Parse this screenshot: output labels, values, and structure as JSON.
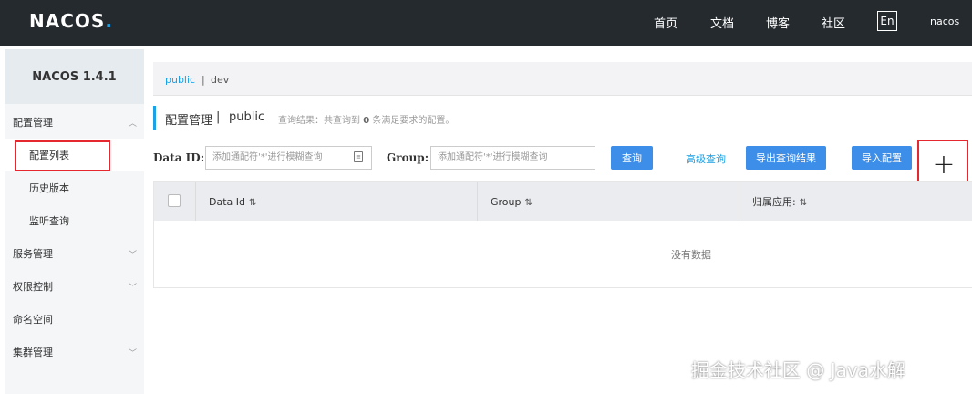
{
  "header": {
    "logo_text": "NACOS",
    "logo_dot": ".",
    "nav": [
      "首页",
      "文档",
      "博客",
      "社区"
    ],
    "lang_button": "En",
    "user": "nacos"
  },
  "sidebar": {
    "version": "NACOS 1.4.1",
    "items": [
      {
        "label": "配置管理",
        "chevron": "︿"
      },
      {
        "label": "配置列表"
      },
      {
        "label": "历史版本"
      },
      {
        "label": "监听查询"
      },
      {
        "label": "服务管理",
        "chevron": "﹀"
      },
      {
        "label": "权限控制",
        "chevron": "﹀"
      },
      {
        "label": "命名空间"
      },
      {
        "label": "集群管理",
        "chevron": "﹀"
      }
    ]
  },
  "namespace_bar": {
    "public": "public",
    "separator": "|",
    "dev": "dev"
  },
  "page": {
    "title": "配置管理",
    "title_separator": "|",
    "namespace": "public",
    "result_prefix": "查询结果：共查询到",
    "result_count": "0",
    "result_suffix": "条满足要求的配置。"
  },
  "filters": {
    "data_id_label": "Data ID:",
    "data_id_placeholder": "添加通配符'*'进行模糊查询",
    "group_label": "Group:",
    "group_placeholder": "添加通配符'*'进行模糊查询",
    "query_button": "查询",
    "advanced_query": "高级查询",
    "export_button": "导出查询结果",
    "import_button": "导入配置",
    "add_button": "+"
  },
  "table": {
    "columns": [
      "Data Id",
      "Group",
      "归属应用:"
    ],
    "sort_glyph": "⇅",
    "empty_text": "没有数据"
  },
  "watermark": "掘金技术社区 @ Java水解",
  "colors": {
    "header_bg": "#252a2f",
    "accent": "#1aa1e6",
    "button_blue": "#3d8ee8",
    "highlight_red": "#e5272f"
  }
}
